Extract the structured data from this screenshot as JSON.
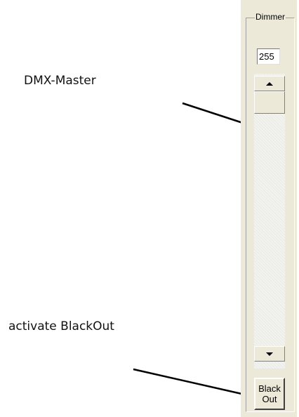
{
  "annotations": {
    "dmx_master": "DMX-Master",
    "activate_blackout": "activate BlackOut"
  },
  "dimmer": {
    "group_label": "Dimmer",
    "value": "255",
    "scroll_up_icon": "arrow-up-icon",
    "scroll_down_icon": "arrow-down-icon",
    "blackout_line1": "Black",
    "blackout_line2": "Out"
  },
  "colors": {
    "panel_bg": "#ece9d8",
    "arrow": "#000000"
  }
}
